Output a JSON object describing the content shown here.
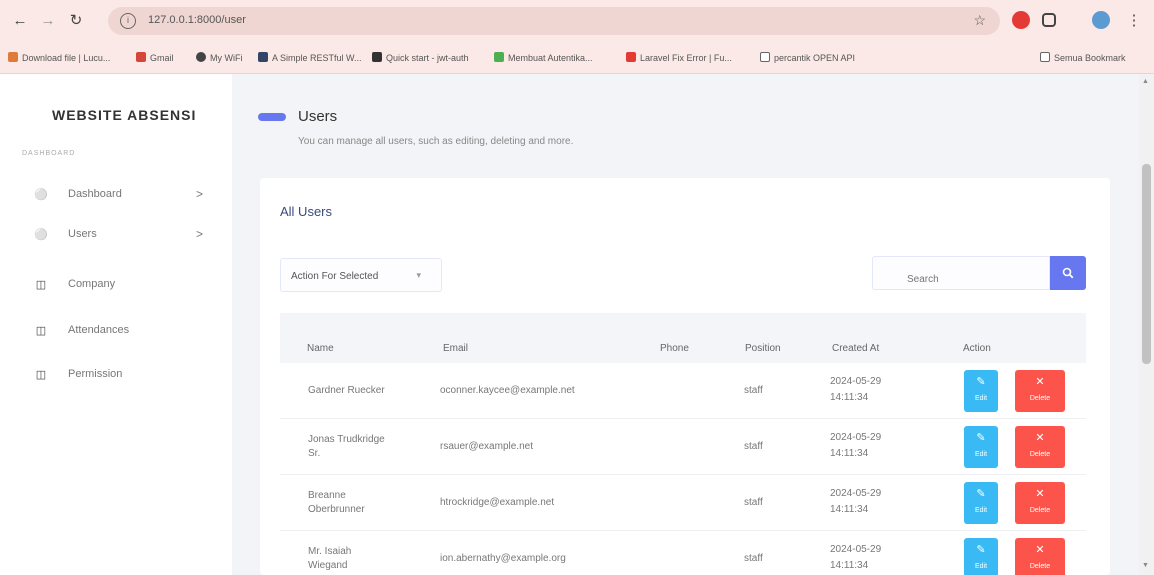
{
  "browser": {
    "url": "127.0.0.1:8000/user",
    "bookmarks": [
      {
        "label": "Download file | Lucu...",
        "color": "#e07a3a"
      },
      {
        "label": "Gmail",
        "color": "#d44638"
      },
      {
        "label": "My WiFi",
        "color": "#444444"
      },
      {
        "label": "A Simple RESTful W...",
        "color": "#334466"
      },
      {
        "label": "Quick start - jwt-auth",
        "color": "#333333"
      },
      {
        "label": "Membuat Autentika...",
        "color": "#4caf50"
      },
      {
        "label": "Laravel Fix Error | Fu...",
        "color": "#e53935"
      },
      {
        "label": "percantik OPEN API",
        "color": "#666666"
      }
    ],
    "all_bookmarks": "Semua Bookmark"
  },
  "sidebar": {
    "brand": "WEBSITE ABSENSI",
    "section": "DASHBOARD",
    "items": [
      {
        "label": "Dashboard",
        "icon": "fire-icon",
        "chevron": ">"
      },
      {
        "label": "Users",
        "icon": "fire-icon",
        "chevron": ">"
      },
      {
        "label": "Company",
        "icon": "columns-icon",
        "chevron": ""
      },
      {
        "label": "Attendances",
        "icon": "columns-icon",
        "chevron": ""
      },
      {
        "label": "Permission",
        "icon": "columns-icon",
        "chevron": ""
      }
    ]
  },
  "page": {
    "title": "Users",
    "subtitle": "You can manage all users, such as editing, deleting and more."
  },
  "card": {
    "title": "All Users",
    "bulk_action": "Action For Selected",
    "search_placeholder": "Search",
    "columns": [
      "Name",
      "Email",
      "Phone",
      "Position",
      "Created At",
      "Action"
    ],
    "edit_label": "Edit",
    "delete_label": "Delete",
    "rows": [
      {
        "name": [
          "Gardner Ruecker"
        ],
        "email": "oconner.kaycee@example.net",
        "phone": "",
        "position": "staff",
        "created": [
          "2024-05-29",
          "14:11:34"
        ]
      },
      {
        "name": [
          "Jonas Trudkridge",
          "Sr."
        ],
        "email": "rsauer@example.net",
        "phone": "",
        "position": "staff",
        "created": [
          "2024-05-29",
          "14:11:34"
        ]
      },
      {
        "name": [
          "Breanne",
          "Oberbrunner"
        ],
        "email": "htrockridge@example.net",
        "phone": "",
        "position": "staff",
        "created": [
          "2024-05-29",
          "14:11:34"
        ]
      },
      {
        "name": [
          "Mr. Isaiah",
          "Wiegand"
        ],
        "email": "ion.abernathy@example.org",
        "phone": "",
        "position": "staff",
        "created": [
          "2024-05-29",
          "14:11:34"
        ]
      }
    ]
  },
  "colors": {
    "primary": "#6777ef",
    "info": "#3abaf4",
    "danger": "#fc544b"
  }
}
